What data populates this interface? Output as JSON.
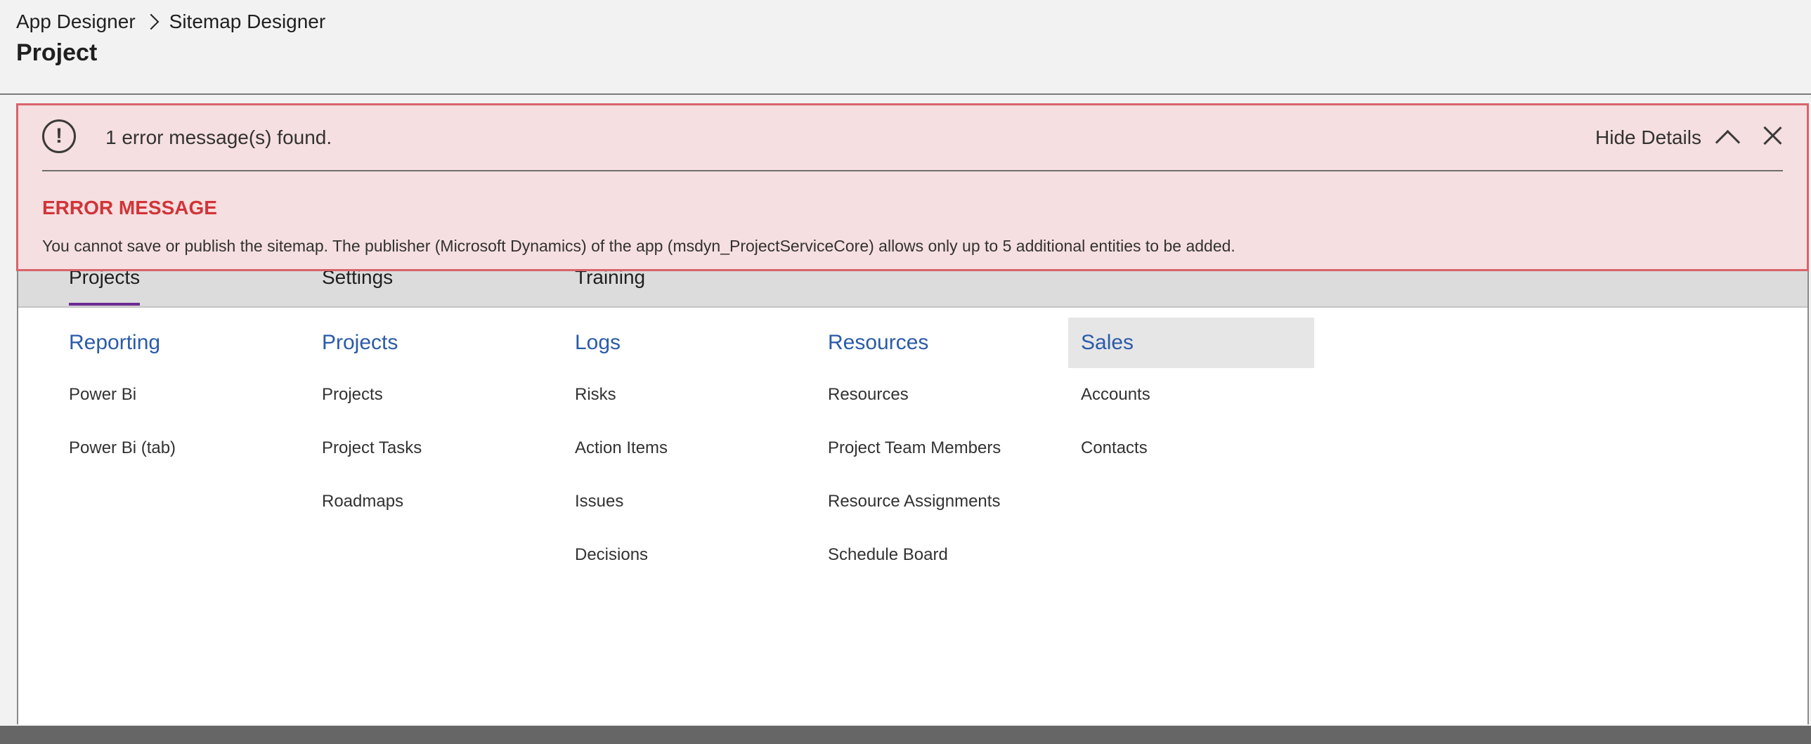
{
  "header": {
    "breadcrumb": [
      "App Designer",
      "Sitemap Designer"
    ],
    "title": "Project"
  },
  "error": {
    "summary": "1 error message(s) found.",
    "hide_details_label": "Hide Details",
    "heading": "ERROR MESSAGE",
    "message": "You cannot save or publish the sitemap. The publisher (Microsoft Dynamics) of the app (msdyn_ProjectServiceCore) allows only up to 5 additional entities to be added.",
    "colors": {
      "background": "#f6dfe0",
      "border": "#d9636b",
      "heading": "#d13438"
    }
  },
  "tabs": [
    {
      "label": "Projects",
      "active": true
    },
    {
      "label": "Settings",
      "active": false
    },
    {
      "label": "Training",
      "active": false
    }
  ],
  "groups": [
    {
      "title": "Reporting",
      "items": [
        "Power Bi",
        "Power Bi (tab)"
      ]
    },
    {
      "title": "Projects",
      "items": [
        "Projects",
        "Project Tasks",
        "Roadmaps"
      ]
    },
    {
      "title": "Logs",
      "items": [
        "Risks",
        "Action Items",
        "Issues",
        "Decisions"
      ]
    },
    {
      "title": "Resources",
      "items": [
        "Resources",
        "Project Team Members",
        "Resource Assignments",
        "Schedule Board"
      ]
    },
    {
      "title": "Sales",
      "items": [
        "Accounts",
        "Contacts"
      ],
      "selected": true
    }
  ],
  "colors": {
    "accent": "#6b2c91",
    "group_title": "#2b5ba8"
  }
}
